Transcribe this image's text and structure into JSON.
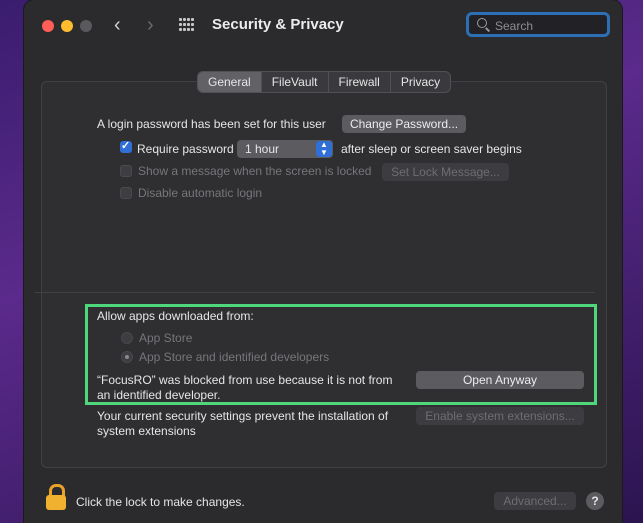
{
  "window": {
    "title": "Security & Privacy",
    "search_placeholder": "Search"
  },
  "tabs": [
    {
      "label": "General",
      "active": true
    },
    {
      "label": "FileVault",
      "active": false
    },
    {
      "label": "Firewall",
      "active": false
    },
    {
      "label": "Privacy",
      "active": false
    }
  ],
  "general": {
    "login_text": "A login password has been set for this user",
    "change_password_label": "Change Password...",
    "require_password_label": "Require password",
    "require_password_checked": true,
    "require_password_value": "1 hour",
    "require_password_suffix": "after sleep or screen saver begins",
    "show_message_label": "Show a message when the screen is locked",
    "set_lock_message_label": "Set Lock Message...",
    "disable_autologin_label": "Disable automatic login"
  },
  "allow_apps": {
    "heading": "Allow apps downloaded from:",
    "options": [
      {
        "label": "App Store",
        "selected": false
      },
      {
        "label": "App Store and identified developers",
        "selected": true
      }
    ],
    "blocked_line1": "“FocusRO” was blocked from use because it is not from",
    "blocked_line2": "an identified developer.",
    "open_anyway_label": "Open Anyway",
    "extensions_line1": "Your current security settings prevent the installation of",
    "extensions_line2": "system extensions",
    "enable_extensions_label": "Enable system extensions..."
  },
  "footer": {
    "lock_text": "Click the lock to make changes.",
    "advanced_label": "Advanced...",
    "help_label": "?"
  },
  "colors": {
    "highlight": "#4fd77c",
    "accent": "#2f6fd6",
    "lock": "#f0b030"
  }
}
